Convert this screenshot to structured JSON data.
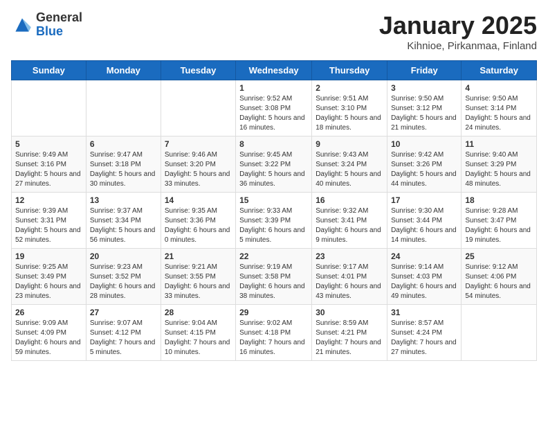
{
  "header": {
    "logo_general": "General",
    "logo_blue": "Blue",
    "month_title": "January 2025",
    "subtitle": "Kihnioe, Pirkanmaa, Finland"
  },
  "days_of_week": [
    "Sunday",
    "Monday",
    "Tuesday",
    "Wednesday",
    "Thursday",
    "Friday",
    "Saturday"
  ],
  "weeks": [
    [
      {
        "day": null,
        "info": null
      },
      {
        "day": null,
        "info": null
      },
      {
        "day": null,
        "info": null
      },
      {
        "day": "1",
        "info": "Sunrise: 9:52 AM\nSunset: 3:08 PM\nDaylight: 5 hours and 16 minutes."
      },
      {
        "day": "2",
        "info": "Sunrise: 9:51 AM\nSunset: 3:10 PM\nDaylight: 5 hours and 18 minutes."
      },
      {
        "day": "3",
        "info": "Sunrise: 9:50 AM\nSunset: 3:12 PM\nDaylight: 5 hours and 21 minutes."
      },
      {
        "day": "4",
        "info": "Sunrise: 9:50 AM\nSunset: 3:14 PM\nDaylight: 5 hours and 24 minutes."
      }
    ],
    [
      {
        "day": "5",
        "info": "Sunrise: 9:49 AM\nSunset: 3:16 PM\nDaylight: 5 hours and 27 minutes."
      },
      {
        "day": "6",
        "info": "Sunrise: 9:47 AM\nSunset: 3:18 PM\nDaylight: 5 hours and 30 minutes."
      },
      {
        "day": "7",
        "info": "Sunrise: 9:46 AM\nSunset: 3:20 PM\nDaylight: 5 hours and 33 minutes."
      },
      {
        "day": "8",
        "info": "Sunrise: 9:45 AM\nSunset: 3:22 PM\nDaylight: 5 hours and 36 minutes."
      },
      {
        "day": "9",
        "info": "Sunrise: 9:43 AM\nSunset: 3:24 PM\nDaylight: 5 hours and 40 minutes."
      },
      {
        "day": "10",
        "info": "Sunrise: 9:42 AM\nSunset: 3:26 PM\nDaylight: 5 hours and 44 minutes."
      },
      {
        "day": "11",
        "info": "Sunrise: 9:40 AM\nSunset: 3:29 PM\nDaylight: 5 hours and 48 minutes."
      }
    ],
    [
      {
        "day": "12",
        "info": "Sunrise: 9:39 AM\nSunset: 3:31 PM\nDaylight: 5 hours and 52 minutes."
      },
      {
        "day": "13",
        "info": "Sunrise: 9:37 AM\nSunset: 3:34 PM\nDaylight: 5 hours and 56 minutes."
      },
      {
        "day": "14",
        "info": "Sunrise: 9:35 AM\nSunset: 3:36 PM\nDaylight: 6 hours and 0 minutes."
      },
      {
        "day": "15",
        "info": "Sunrise: 9:33 AM\nSunset: 3:39 PM\nDaylight: 6 hours and 5 minutes."
      },
      {
        "day": "16",
        "info": "Sunrise: 9:32 AM\nSunset: 3:41 PM\nDaylight: 6 hours and 9 minutes."
      },
      {
        "day": "17",
        "info": "Sunrise: 9:30 AM\nSunset: 3:44 PM\nDaylight: 6 hours and 14 minutes."
      },
      {
        "day": "18",
        "info": "Sunrise: 9:28 AM\nSunset: 3:47 PM\nDaylight: 6 hours and 19 minutes."
      }
    ],
    [
      {
        "day": "19",
        "info": "Sunrise: 9:25 AM\nSunset: 3:49 PM\nDaylight: 6 hours and 23 minutes."
      },
      {
        "day": "20",
        "info": "Sunrise: 9:23 AM\nSunset: 3:52 PM\nDaylight: 6 hours and 28 minutes."
      },
      {
        "day": "21",
        "info": "Sunrise: 9:21 AM\nSunset: 3:55 PM\nDaylight: 6 hours and 33 minutes."
      },
      {
        "day": "22",
        "info": "Sunrise: 9:19 AM\nSunset: 3:58 PM\nDaylight: 6 hours and 38 minutes."
      },
      {
        "day": "23",
        "info": "Sunrise: 9:17 AM\nSunset: 4:01 PM\nDaylight: 6 hours and 43 minutes."
      },
      {
        "day": "24",
        "info": "Sunrise: 9:14 AM\nSunset: 4:03 PM\nDaylight: 6 hours and 49 minutes."
      },
      {
        "day": "25",
        "info": "Sunrise: 9:12 AM\nSunset: 4:06 PM\nDaylight: 6 hours and 54 minutes."
      }
    ],
    [
      {
        "day": "26",
        "info": "Sunrise: 9:09 AM\nSunset: 4:09 PM\nDaylight: 6 hours and 59 minutes."
      },
      {
        "day": "27",
        "info": "Sunrise: 9:07 AM\nSunset: 4:12 PM\nDaylight: 7 hours and 5 minutes."
      },
      {
        "day": "28",
        "info": "Sunrise: 9:04 AM\nSunset: 4:15 PM\nDaylight: 7 hours and 10 minutes."
      },
      {
        "day": "29",
        "info": "Sunrise: 9:02 AM\nSunset: 4:18 PM\nDaylight: 7 hours and 16 minutes."
      },
      {
        "day": "30",
        "info": "Sunrise: 8:59 AM\nSunset: 4:21 PM\nDaylight: 7 hours and 21 minutes."
      },
      {
        "day": "31",
        "info": "Sunrise: 8:57 AM\nSunset: 4:24 PM\nDaylight: 7 hours and 27 minutes."
      },
      {
        "day": null,
        "info": null
      }
    ]
  ]
}
